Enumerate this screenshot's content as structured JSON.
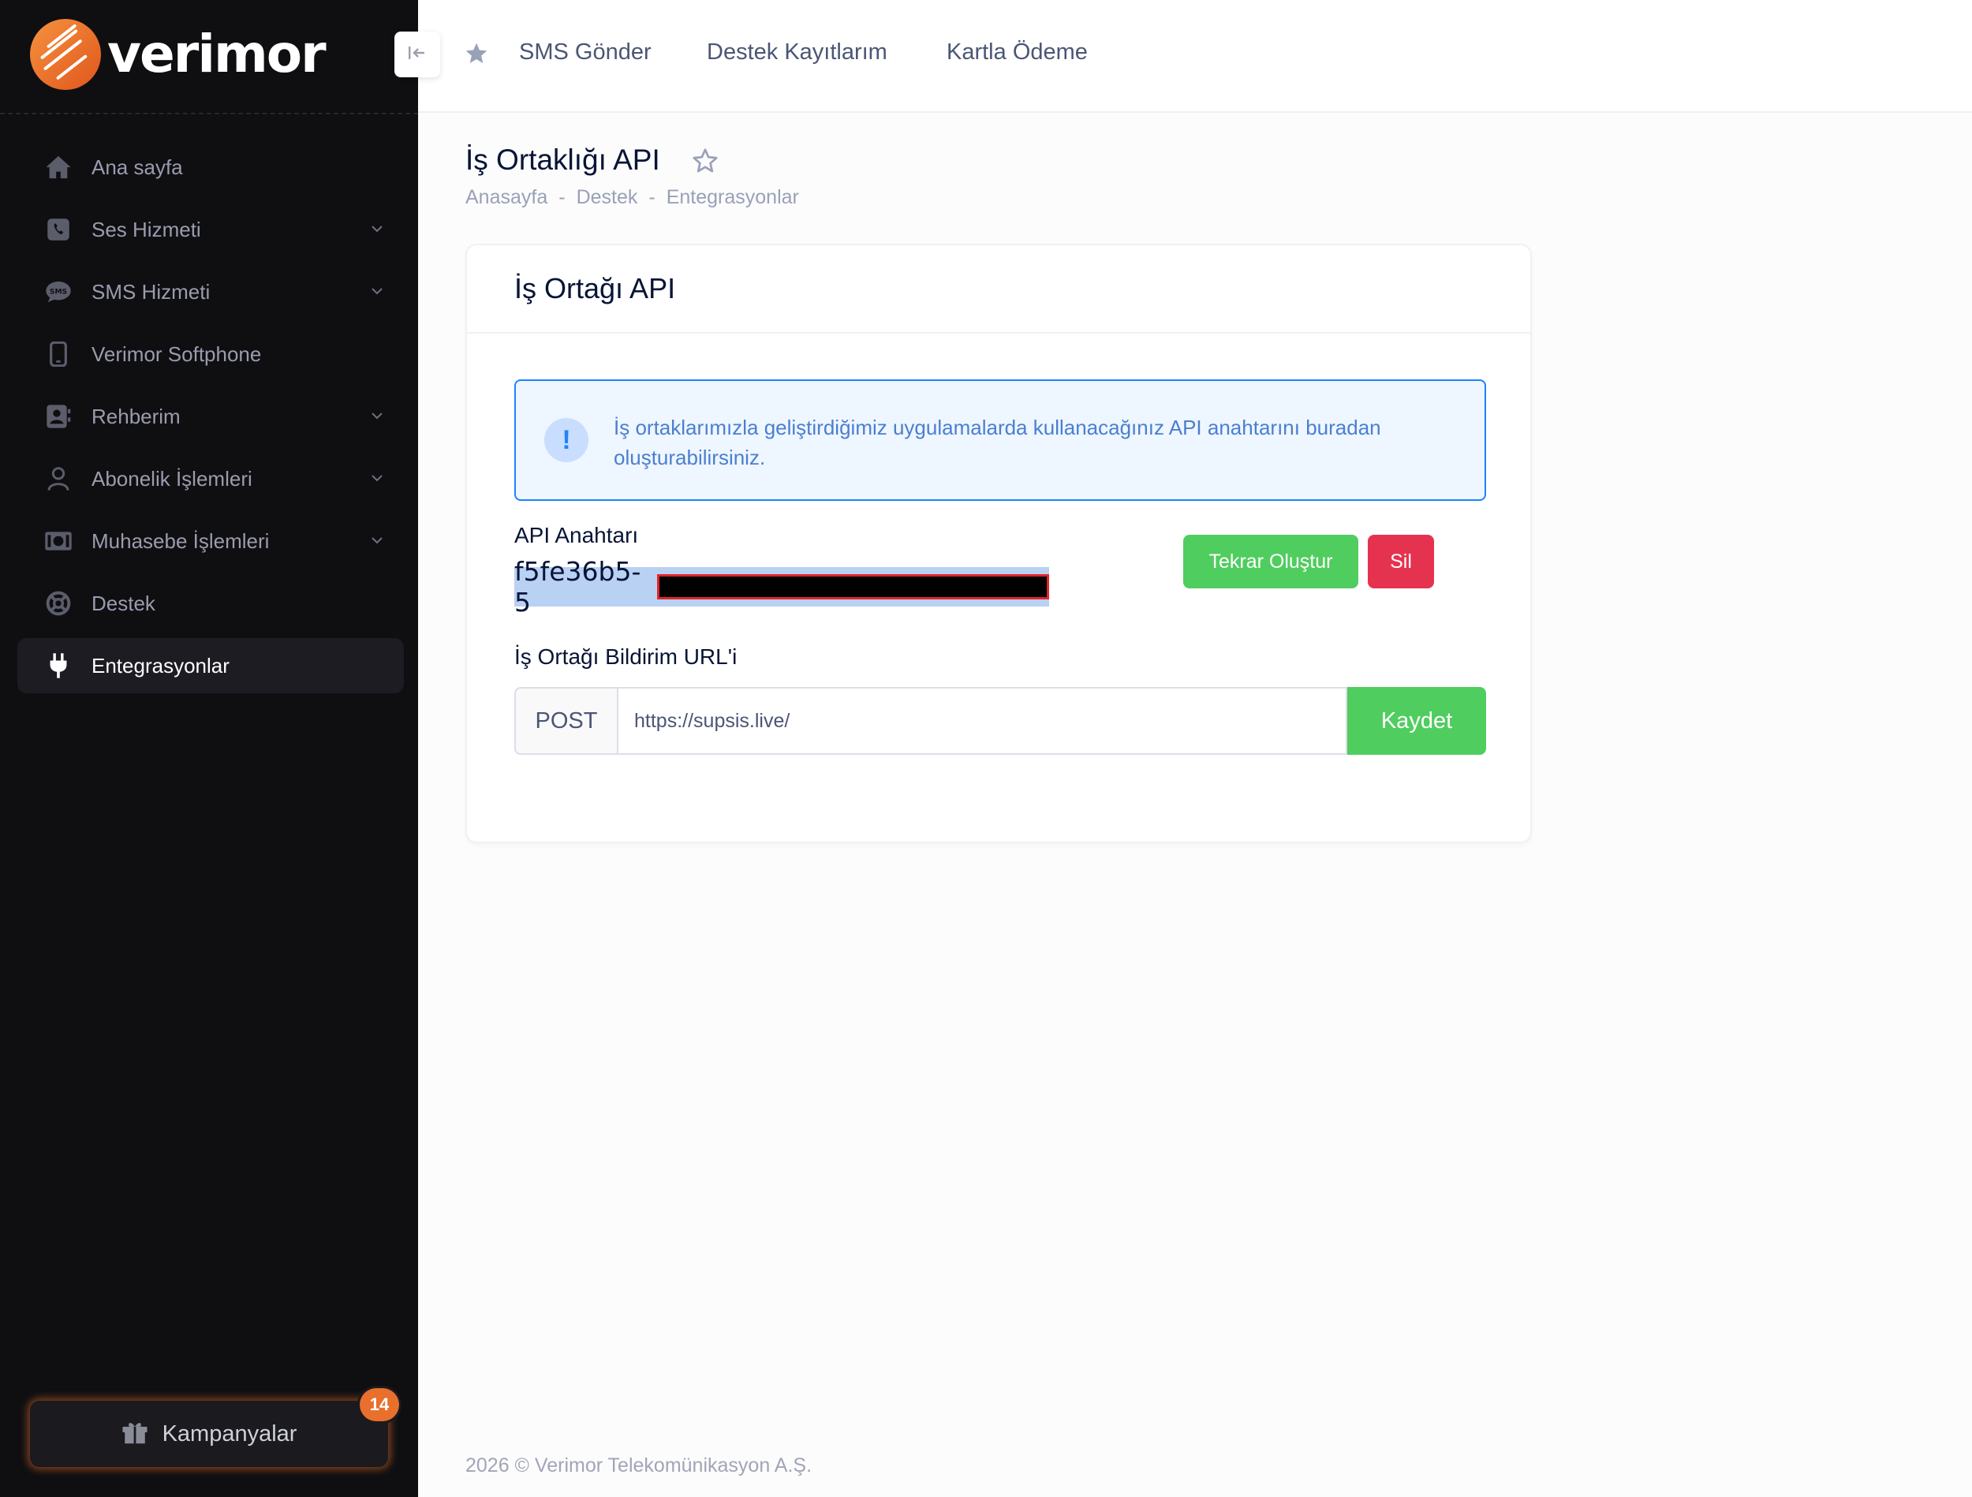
{
  "brand": {
    "name": "verimor"
  },
  "sidebar": {
    "items": [
      {
        "label": "Ana sayfa",
        "icon": "home-icon",
        "expandable": false,
        "active": false
      },
      {
        "label": "Ses Hizmeti",
        "icon": "phone-icon",
        "expandable": true,
        "active": false
      },
      {
        "label": "SMS Hizmeti",
        "icon": "sms-icon",
        "expandable": true,
        "active": false
      },
      {
        "label": "Verimor Softphone",
        "icon": "mobile-icon",
        "expandable": false,
        "active": false
      },
      {
        "label": "Rehberim",
        "icon": "contact-book-icon",
        "expandable": true,
        "active": false
      },
      {
        "label": "Abonelik İşlemleri",
        "icon": "user-icon",
        "expandable": true,
        "active": false
      },
      {
        "label": "Muhasebe İşlemleri",
        "icon": "money-icon",
        "expandable": true,
        "active": false
      },
      {
        "label": "Destek",
        "icon": "lifebuoy-icon",
        "expandable": false,
        "active": false
      },
      {
        "label": "Entegrasyonlar",
        "icon": "plug-icon",
        "expandable": false,
        "active": true
      }
    ],
    "campaigns": {
      "label": "Kampanyalar",
      "badge": "14"
    }
  },
  "topbar": {
    "links": [
      "SMS Gönder",
      "Destek Kayıtlarım",
      "Kartla Ödeme"
    ]
  },
  "page": {
    "title": "İş Ortaklığı API",
    "breadcrumb": [
      "Anasayfa",
      "Destek",
      "Entegrasyonlar"
    ]
  },
  "card": {
    "title": "İş Ortağı API",
    "alert": "İş ortaklarımızla geliştirdiğimiz uygulamalarda kullanacağınız API anahtarını buradan oluşturabilirsiniz.",
    "api_label": "API Anahtarı",
    "api_key_visible": "f5fe36b5-5",
    "regenerate_label": "Tekrar Oluştur",
    "delete_label": "Sil",
    "url_label": "İş Ortağı Bildirim URL'i",
    "method": "POST",
    "url_value": "https://supsis.live/",
    "save_label": "Kaydet"
  },
  "footer": "2026 © Verimor Telekomünikasyon A.Ş.",
  "colors": {
    "sidebar_bg": "#0f0f12",
    "accent_orange": "#e86f2c",
    "success": "#50cd5f",
    "danger": "#e5334f",
    "info": "#1b84ff"
  }
}
